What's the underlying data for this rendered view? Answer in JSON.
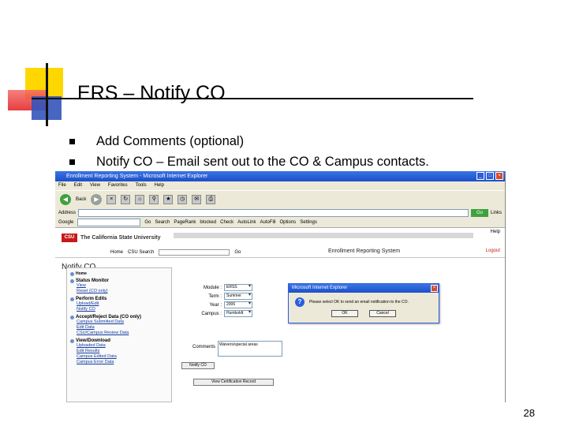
{
  "slide": {
    "title": "ERS – Notify CO",
    "bullets": [
      "Add Comments (optional)",
      "Notify CO – Email sent out to the CO & Campus contacts."
    ],
    "page_number": "28"
  },
  "browser": {
    "window_title": "Enrollment Reporting System - Microsoft Internet Explorer",
    "menu": [
      "File",
      "Edit",
      "View",
      "Favorites",
      "Tools",
      "Help"
    ],
    "toolbar": {
      "back_label": "Back"
    },
    "address_label": "Address",
    "go_label": "Go",
    "links_label": "Links",
    "google_label": "Google",
    "google_items": [
      "Go",
      "Search",
      "PageRank",
      "blocked",
      "Check",
      "AutoLink",
      "AutoFill",
      "Options"
    ],
    "settings_label": "Settings"
  },
  "site": {
    "logo_text": "CSU",
    "name": "The California State University",
    "home_link": "Home",
    "search_link": "CSU Search",
    "go_label": "Go",
    "app_title": "Enrollment Reporting System",
    "help_label": "Help",
    "logout_label": "Logout",
    "page_heading": "Notify CO"
  },
  "sidebar": [
    {
      "heading": "Home",
      "links": []
    },
    {
      "heading": "Status Monitor",
      "links": [
        "View",
        "Reset (CO only)"
      ]
    },
    {
      "heading": "Perform Edits",
      "links": [
        "Upload/Edit",
        "Notify CO"
      ]
    },
    {
      "heading": "Accept/Reject Data (CO only)",
      "links": [
        "Campus Submitted Data",
        "Edit Data",
        "CSU/Campus Review Data"
      ]
    },
    {
      "heading": "View/Download",
      "links": [
        "Uploaded Data",
        "Edit Results",
        "Campus Edited Data",
        "Campus Error Data"
      ]
    }
  ],
  "form": {
    "fields": [
      {
        "label": "Module :",
        "value": "ERSS"
      },
      {
        "label": "Term :",
        "value": "Summer"
      },
      {
        "label": "Year :",
        "value": "2006"
      },
      {
        "label": "Campus :",
        "value": "Humboldt"
      }
    ],
    "comments_label": "Comments",
    "comments_value": "Waivers/special areas",
    "notify_button": "Notify CO",
    "view_button": "View Certification Record"
  },
  "dialog": {
    "title": "Microsoft Internet Explorer",
    "message": "Please select OK to send an email notification to the CO.",
    "ok_label": "OK",
    "cancel_label": "Cancel"
  }
}
